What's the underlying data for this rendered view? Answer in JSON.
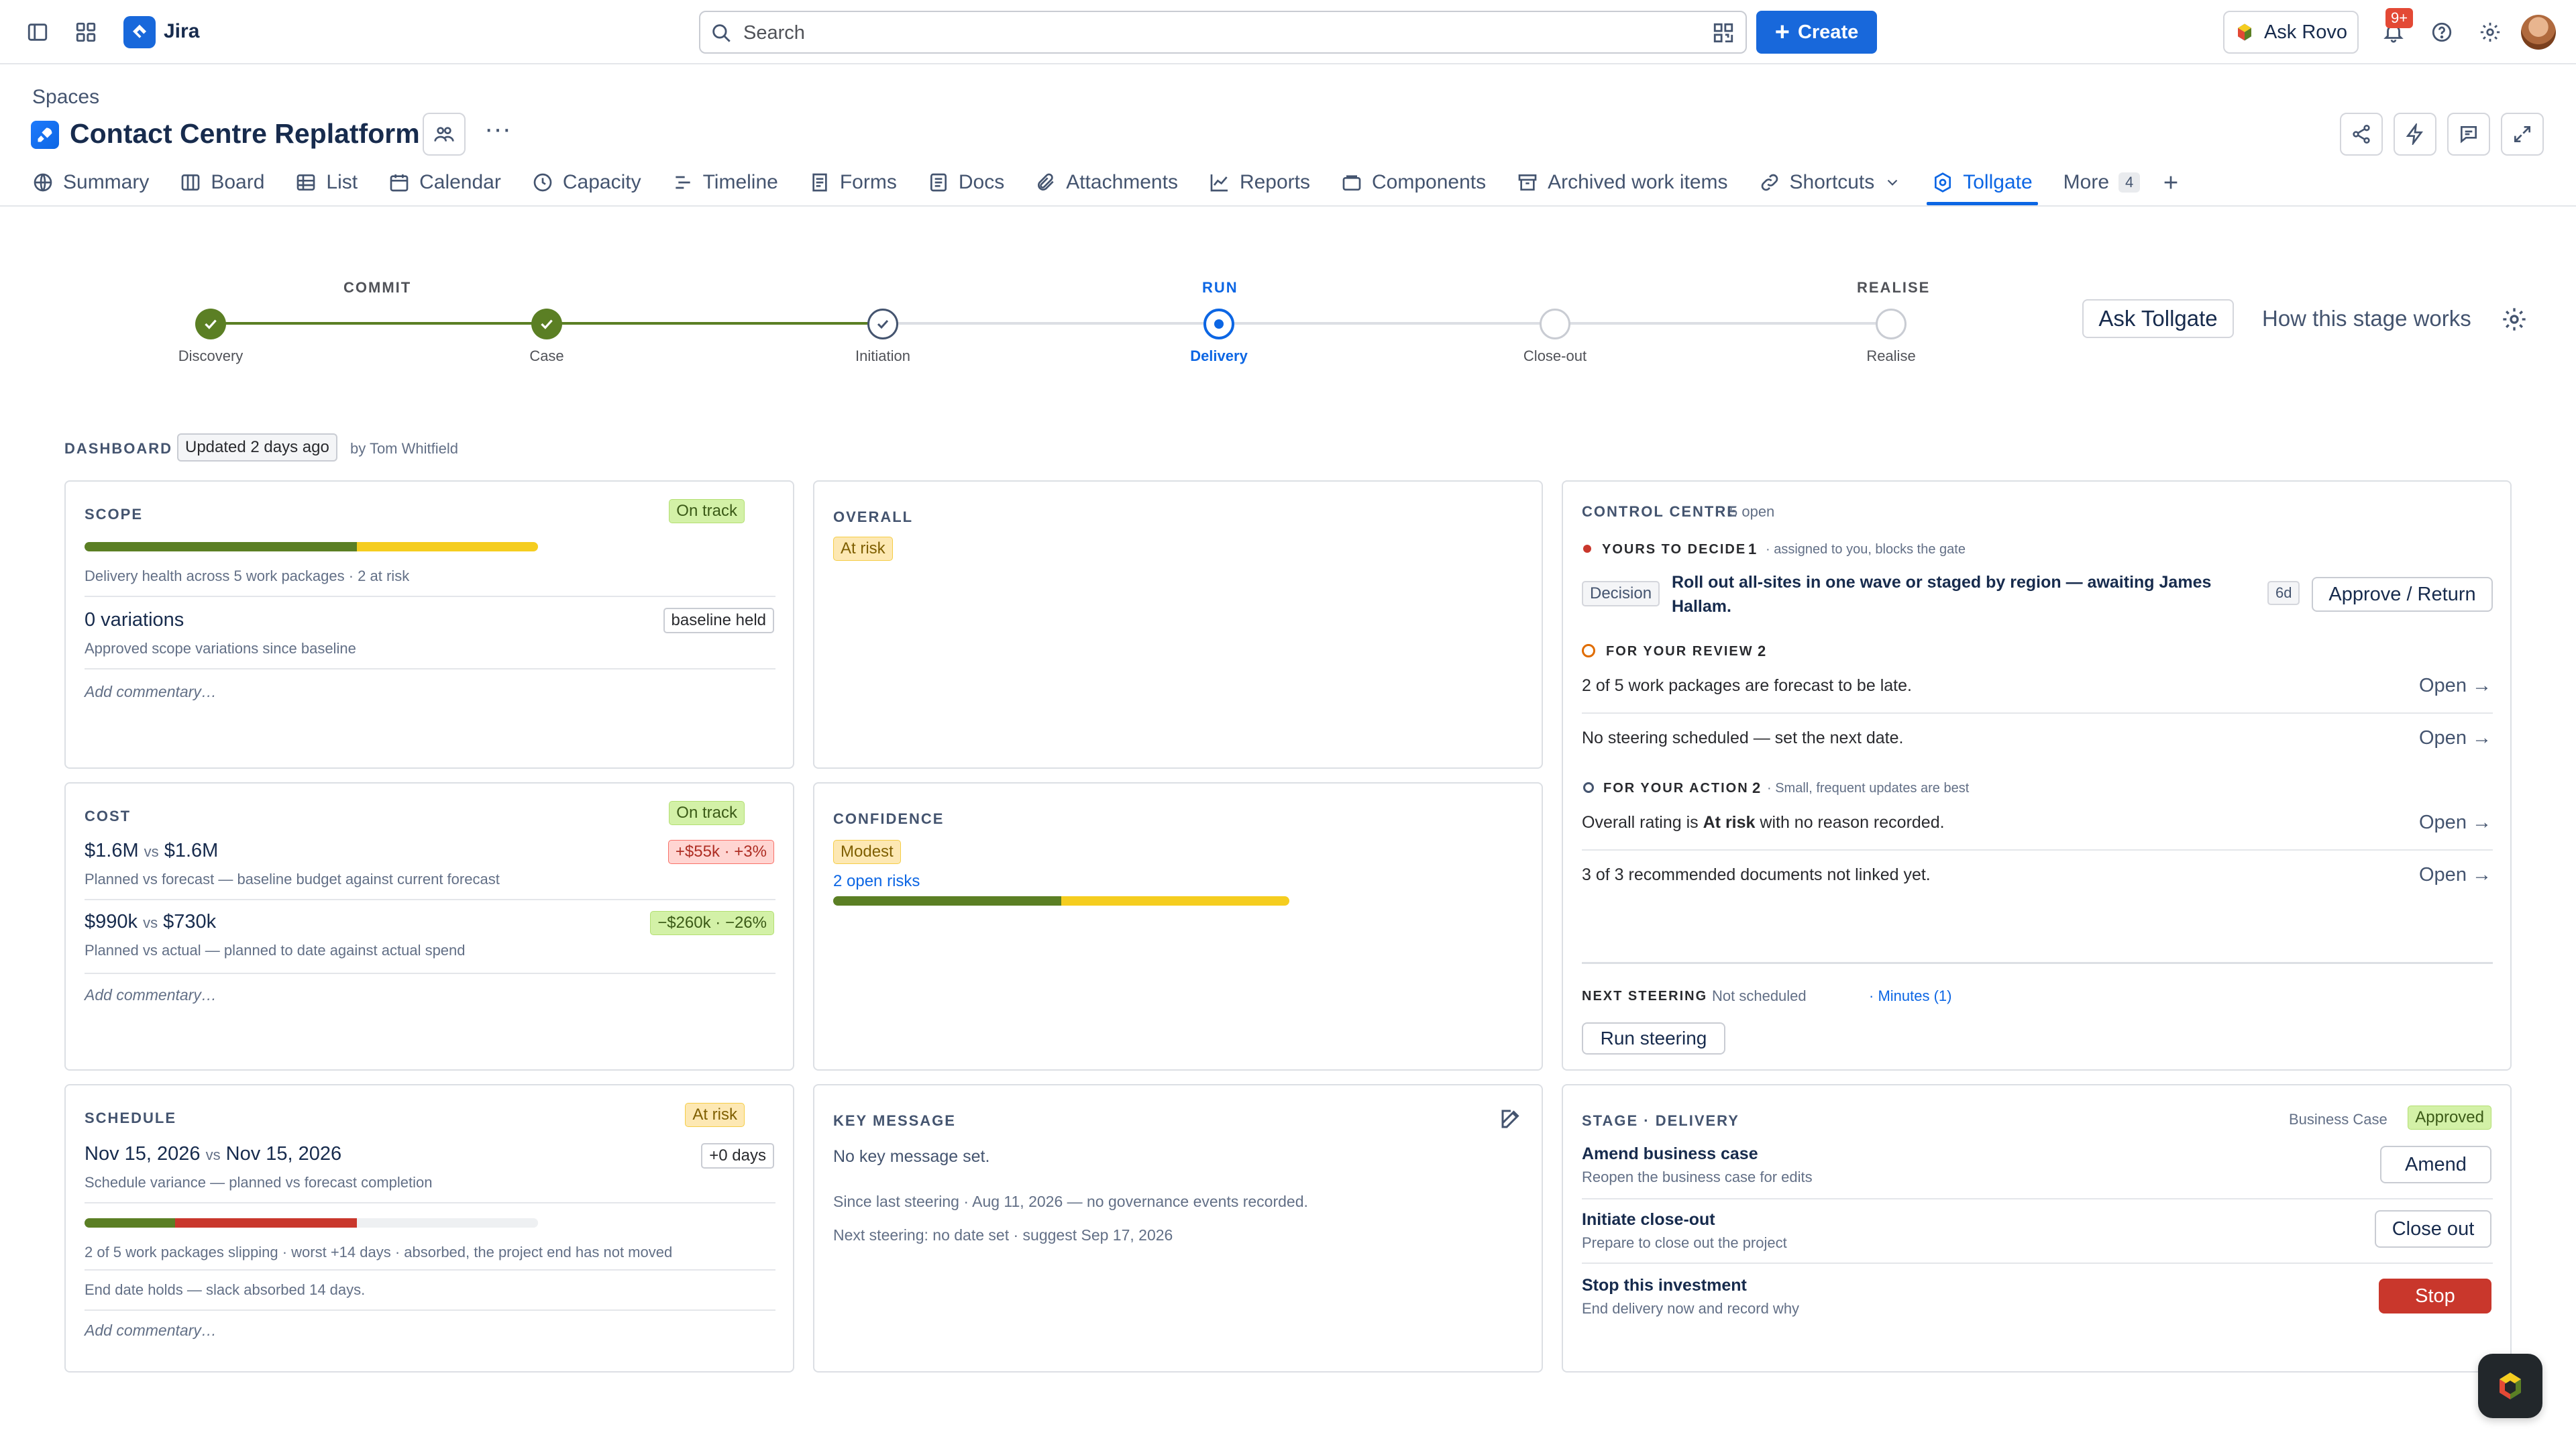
{
  "topbar": {
    "app_name": "Jira",
    "search_placeholder": "Search",
    "create_label": "Create",
    "ask_rovo_label": "Ask Rovo",
    "notifications_badge": "9+"
  },
  "space": {
    "breadcrumb": "Spaces",
    "title": "Contact Centre Replatform"
  },
  "tabs": [
    {
      "label": "Summary",
      "icon": "globe-icon"
    },
    {
      "label": "Board",
      "icon": "board-icon"
    },
    {
      "label": "List",
      "icon": "list-icon"
    },
    {
      "label": "Calendar",
      "icon": "calendar-icon"
    },
    {
      "label": "Capacity",
      "icon": "clock-icon"
    },
    {
      "label": "Timeline",
      "icon": "timeline-icon"
    },
    {
      "label": "Forms",
      "icon": "forms-icon"
    },
    {
      "label": "Docs",
      "icon": "docs-icon"
    },
    {
      "label": "Attachments",
      "icon": "paperclip-icon"
    },
    {
      "label": "Reports",
      "icon": "chart-line-icon"
    },
    {
      "label": "Components",
      "icon": "component-icon"
    },
    {
      "label": "Archived work items",
      "icon": "archive-icon"
    },
    {
      "label": "Shortcuts",
      "icon": "link-icon"
    },
    {
      "label": "Tollgate",
      "icon": "tollgate-icon",
      "active": true
    },
    {
      "label": "More",
      "count": "4"
    }
  ],
  "stepper": {
    "phases": {
      "commit": "COMMIT",
      "run": "RUN",
      "realise": "REALISE"
    },
    "steps": [
      {
        "label": "Discovery",
        "state": "done"
      },
      {
        "label": "Case",
        "state": "done"
      },
      {
        "label": "Initiation",
        "state": "checked"
      },
      {
        "label": "Delivery",
        "state": "current"
      },
      {
        "label": "Close-out",
        "state": "todo"
      },
      {
        "label": "Realise",
        "state": "todo"
      }
    ],
    "ask_label": "Ask Tollgate",
    "how_label": "How this stage works"
  },
  "dashboard": {
    "label": "DASHBOARD",
    "updated": "Updated 2 days ago",
    "by": "by Tom Whitfield"
  },
  "scope": {
    "title": "SCOPE",
    "status": "On track",
    "health_text": "Delivery health across 5 work packages · 2 at risk",
    "health_bar": {
      "green_fraction": 0.6,
      "yellow_fraction": 0.4
    },
    "variations": "0 variations",
    "variations_badge": "baseline held",
    "variations_sub": "Approved scope variations since baseline",
    "commentary": "Add commentary…"
  },
  "overall": {
    "title": "OVERALL",
    "status": "At risk"
  },
  "control": {
    "title": "CONTROL CENTRE",
    "open_count": "5 open",
    "decide_h": "YOURS TO DECIDE",
    "decide_n": "1",
    "decide_note": "· assigned to you, blocks the gate",
    "decision_tag": "Decision",
    "decision_text": "Roll out all-sites in one wave or staged by region — awaiting",
    "decision_person": "James Hallam.",
    "decision_age": "6d",
    "decision_btn": "Approve / Return",
    "review_h": "FOR YOUR REVIEW",
    "review_n": "2",
    "review_items": [
      "2 of 5 work packages are forecast to be late.",
      "No steering scheduled — set the next date."
    ],
    "action_h": "FOR YOUR ACTION",
    "action_n": "2",
    "action_note": "· Small, frequent updates are best",
    "action_item_1_a": "Overall rating is",
    "action_item_1_b": "At risk",
    "action_item_1_c": "with no reason recorded.",
    "action_item_2": "3 of 3 recommended documents not linked yet.",
    "open_label": "Open →",
    "next_steering_h": "NEXT STEERING",
    "next_steering_val": "Not scheduled",
    "minutes_link": "· Minutes (1)",
    "run_steering_btn": "Run steering"
  },
  "cost": {
    "title": "COST",
    "status": "On track",
    "line1_a": "$1.6M",
    "line1_vs": "vs",
    "line1_b": "$1.6M",
    "line1_badge": "+$55k · +3%",
    "line1_sub": "Planned vs forecast — baseline budget against current forecast",
    "line2_a": "$990k",
    "line2_vs": "vs",
    "line2_b": "$730k",
    "line2_badge": "−$260k · −26%",
    "line2_sub": "Planned vs actual — planned to date against actual spend",
    "commentary": "Add commentary…"
  },
  "confidence": {
    "title": "CONFIDENCE",
    "status": "Modest",
    "risks_link": "2 open risks",
    "bar": {
      "green_fraction": 0.5,
      "yellow_fraction": 0.5
    }
  },
  "schedule": {
    "title": "SCHEDULE",
    "status": "At risk",
    "date_a": "Nov 15, 2026",
    "date_vs": "vs",
    "date_b": "Nov 15, 2026",
    "days_badge": "+0 days",
    "sub": "Schedule variance — planned vs forecast completion",
    "bar": {
      "green_fraction": 0.2,
      "red_fraction": 0.4,
      "gray_fraction": 0.4
    },
    "slipping_text": "2 of 5 work packages slipping · worst +14 days · absorbed, the project end has not moved",
    "end_date_text": "End date holds — slack absorbed 14 days.",
    "commentary": "Add commentary…"
  },
  "key_message": {
    "title": "KEY MESSAGE",
    "body": "No key message set.",
    "since": "Since last steering · Aug 11, 2026 — no governance events recorded.",
    "next": "Next steering: no date set · suggest Sep 17, 2026"
  },
  "stage": {
    "title": "STAGE · DELIVERY",
    "bc_label": "Business Case",
    "bc_status": "Approved",
    "rows": [
      {
        "title": "Amend business case",
        "sub": "Reopen the business case for edits",
        "btn": "Amend"
      },
      {
        "title": "Initiate close-out",
        "sub": "Prepare to close out the project",
        "btn": "Close out"
      },
      {
        "title": "Stop this investment",
        "sub": "End delivery now and record why",
        "btn": "Stop"
      }
    ]
  },
  "colors": {
    "brand": "#1868db",
    "green": "#5b7f24",
    "yellow": "#f5cd1f",
    "red": "#c9372c"
  }
}
